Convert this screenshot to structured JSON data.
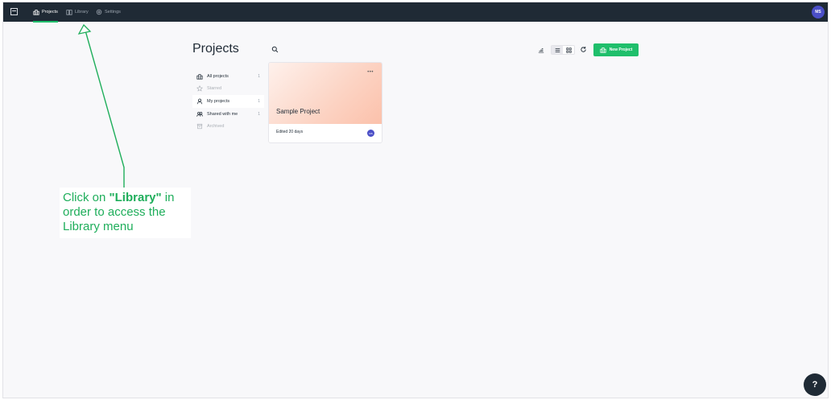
{
  "topbar": {
    "nav": [
      {
        "label": "Projects",
        "icon": "projects-icon",
        "active": true
      },
      {
        "label": "Library",
        "icon": "book-icon",
        "active": false
      },
      {
        "label": "Settings",
        "icon": "gear-icon",
        "active": false
      }
    ],
    "user_initials": "MS"
  },
  "main": {
    "title": "Projects",
    "new_project_label": "New Project"
  },
  "sidebar": {
    "items": [
      {
        "label": "All projects",
        "count": "1",
        "icon": "buildings-icon"
      },
      {
        "label": "Starred",
        "count": "",
        "icon": "star-icon"
      },
      {
        "label": "My projects",
        "count": "1",
        "icon": "user-icon"
      },
      {
        "label": "Shared with me",
        "count": "1",
        "icon": "users-icon"
      },
      {
        "label": "Archived",
        "count": "",
        "icon": "archive-icon"
      }
    ]
  },
  "card": {
    "title": "Sample Project",
    "edited": "Edited 20 days",
    "menu": "•••",
    "avatar_initials": "MS"
  },
  "annotation": {
    "pre": "Click on ",
    "strong": "\"Library\"",
    "post": " in order to access the Library menu",
    "color": "#1fae5b"
  },
  "help_label": "?",
  "colors": {
    "accent": "#1fbf6b",
    "topbar": "#1f2a35",
    "avatar": "#4b4fc7"
  }
}
